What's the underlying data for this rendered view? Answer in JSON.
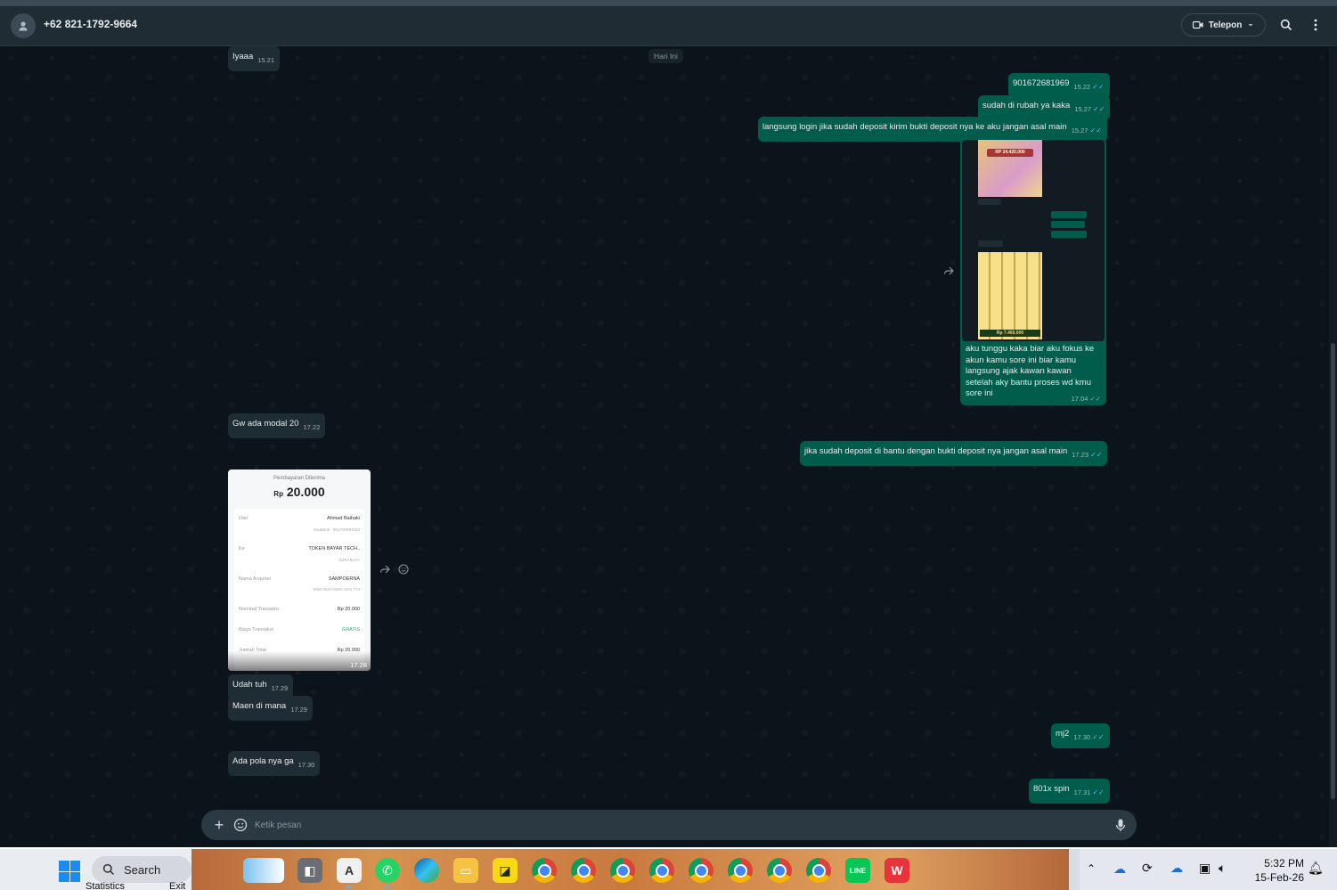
{
  "header": {
    "contact": "+62 821-1792-9664",
    "call_label": "Telepon",
    "icons": [
      "person-icon",
      "video-icon",
      "chevron-down-icon",
      "search-icon",
      "more-vertical-icon"
    ]
  },
  "chat": {
    "date_chip": "Hari Ini",
    "messages": [
      {
        "dir": "in",
        "text": "Iyaaa",
        "time": "15.21"
      },
      {
        "dir": "out",
        "text": "901672681969",
        "time": "15.22"
      },
      {
        "dir": "out",
        "text": "sudah di rubah ya kaka",
        "time": "15.27"
      },
      {
        "dir": "out",
        "text": "langsung login jika sudah deposit kirim bukti deposit nya ke aku jangan asal main",
        "time": "15.27"
      },
      {
        "dir": "out",
        "text": "aku tunggu kaka biar aku fokus ke akun kamu sore ini biar kamu langsung ajak kawan kawan setelah aky bantu proses wd kmu sore ini",
        "time": "17.04"
      },
      {
        "dir": "in",
        "text": "Gw ada modal 20",
        "time": "17.22"
      },
      {
        "dir": "out",
        "text": "jika sudah deposit di bantu dengan bukti deposit nya jangan asal main",
        "time": "17.23"
      },
      {
        "dir": "in",
        "text": "Udah tuh",
        "time": "17.29"
      },
      {
        "dir": "in",
        "text": "Maen di mana",
        "time": "17.29"
      },
      {
        "dir": "out",
        "text": "mj2",
        "time": "17.30"
      },
      {
        "dir": "in",
        "text": "Ada pola nya ga",
        "time": "17.30"
      },
      {
        "dir": "out",
        "text": "801x spin",
        "time": "17.31"
      }
    ],
    "receipt": {
      "title": "Pembayaran Diterima",
      "currency": "Rp",
      "amount": "20.000",
      "from_label": "Dari",
      "from_name": "Ahmad Baihaki",
      "from_sub": "SeaBank · 901730697044",
      "to_label": "Ke",
      "to_name": "TOKEN BAYAR TECH..",
      "to_sub": "SURABAYA",
      "acquirer_label": "Nama Acquirer",
      "acquirer_value": "SAMPOERNA",
      "acquirer_sub": "9360 0523 0000 0101 774",
      "nominal_label": "Nominal Transaksi",
      "nominal_value": "Rp 20.000",
      "fee_label": "Biaya Transaksi",
      "fee_value": "GRATIS",
      "total_label": "Jumlah Total",
      "total_value": "Rp 20.000",
      "time": "17.28"
    },
    "image_caption_time": "17.04",
    "image_texts": {
      "win1": "RP 24.420.000",
      "win2": "Rp 7.460.000"
    }
  },
  "composer": {
    "placeholder": "Ketik pesan",
    "icons": [
      "plus-icon",
      "sticker-icon",
      "mic-icon"
    ]
  },
  "taskbar": {
    "search_label": "Search",
    "statistics_label": "Statistics",
    "exit_label": "Exit",
    "time": "5:32 PM",
    "date": "15-Feb-26"
  },
  "colors": {
    "outgoing": "#005c4b",
    "incoming": "#202c33",
    "background": "#0b141a",
    "ticks": "#53bdeb"
  }
}
